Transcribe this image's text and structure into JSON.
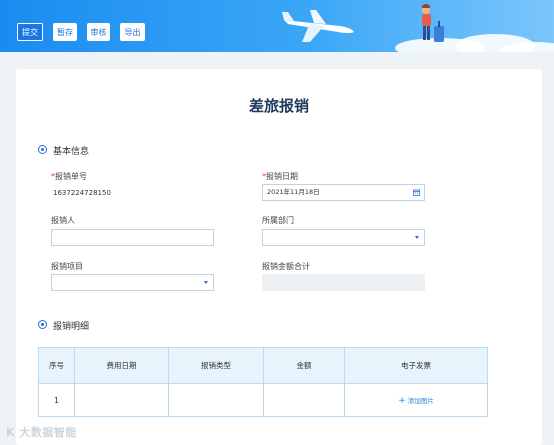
{
  "toolbar": {
    "submit": "提交",
    "save_draft": "暂存",
    "audit": "审核",
    "export": "导出"
  },
  "form": {
    "title": "差旅报销",
    "basic_section_title": "基本信息",
    "report_no": {
      "label": "报销单号",
      "value": "1637224728150"
    },
    "report_date": {
      "label": "报销日期",
      "value": "2021年11月18日"
    },
    "reporter": {
      "label": "报销人",
      "value": ""
    },
    "department": {
      "label": "所属部门",
      "value": ""
    },
    "project": {
      "label": "报销项目",
      "value": ""
    },
    "total_amount": {
      "label": "报销金额合计",
      "value": ""
    }
  },
  "detail": {
    "section_title": "报销明细",
    "columns": [
      "序号",
      "费用日期",
      "报销类型",
      "金额",
      "电子发票"
    ],
    "rows": [
      {
        "index": "1",
        "date": "",
        "type": "",
        "amount": "",
        "invoice_action": "添加图片"
      }
    ]
  },
  "watermark": "K 大数据智能",
  "colors": {
    "primary": "#1677e6",
    "header_gradient_start": "#1a8cf0",
    "required": "#e53935",
    "table_header_bg": "#e8f4fc"
  }
}
